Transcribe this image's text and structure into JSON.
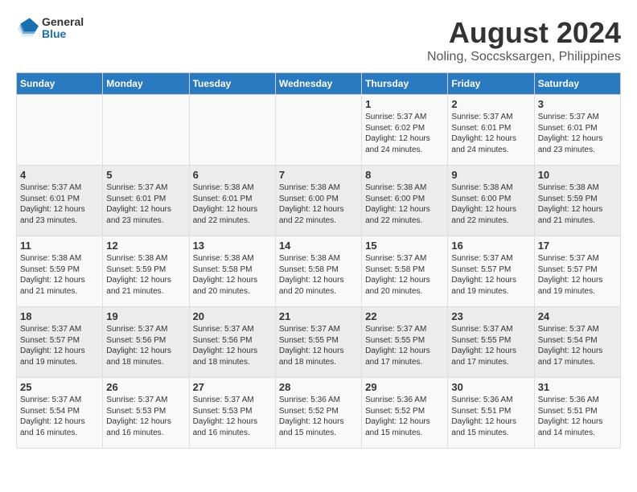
{
  "header": {
    "logo_general": "General",
    "logo_blue": "Blue",
    "main_title": "August 2024",
    "subtitle": "Noling, Soccsksargen, Philippines"
  },
  "calendar": {
    "days_of_week": [
      "Sunday",
      "Monday",
      "Tuesday",
      "Wednesday",
      "Thursday",
      "Friday",
      "Saturday"
    ],
    "weeks": [
      [
        {
          "day": "",
          "content": ""
        },
        {
          "day": "",
          "content": ""
        },
        {
          "day": "",
          "content": ""
        },
        {
          "day": "",
          "content": ""
        },
        {
          "day": "1",
          "content": "Sunrise: 5:37 AM\nSunset: 6:02 PM\nDaylight: 12 hours\nand 24 minutes."
        },
        {
          "day": "2",
          "content": "Sunrise: 5:37 AM\nSunset: 6:01 PM\nDaylight: 12 hours\nand 24 minutes."
        },
        {
          "day": "3",
          "content": "Sunrise: 5:37 AM\nSunset: 6:01 PM\nDaylight: 12 hours\nand 23 minutes."
        }
      ],
      [
        {
          "day": "4",
          "content": "Sunrise: 5:37 AM\nSunset: 6:01 PM\nDaylight: 12 hours\nand 23 minutes."
        },
        {
          "day": "5",
          "content": "Sunrise: 5:37 AM\nSunset: 6:01 PM\nDaylight: 12 hours\nand 23 minutes."
        },
        {
          "day": "6",
          "content": "Sunrise: 5:38 AM\nSunset: 6:01 PM\nDaylight: 12 hours\nand 22 minutes."
        },
        {
          "day": "7",
          "content": "Sunrise: 5:38 AM\nSunset: 6:00 PM\nDaylight: 12 hours\nand 22 minutes."
        },
        {
          "day": "8",
          "content": "Sunrise: 5:38 AM\nSunset: 6:00 PM\nDaylight: 12 hours\nand 22 minutes."
        },
        {
          "day": "9",
          "content": "Sunrise: 5:38 AM\nSunset: 6:00 PM\nDaylight: 12 hours\nand 22 minutes."
        },
        {
          "day": "10",
          "content": "Sunrise: 5:38 AM\nSunset: 5:59 PM\nDaylight: 12 hours\nand 21 minutes."
        }
      ],
      [
        {
          "day": "11",
          "content": "Sunrise: 5:38 AM\nSunset: 5:59 PM\nDaylight: 12 hours\nand 21 minutes."
        },
        {
          "day": "12",
          "content": "Sunrise: 5:38 AM\nSunset: 5:59 PM\nDaylight: 12 hours\nand 21 minutes."
        },
        {
          "day": "13",
          "content": "Sunrise: 5:38 AM\nSunset: 5:58 PM\nDaylight: 12 hours\nand 20 minutes."
        },
        {
          "day": "14",
          "content": "Sunrise: 5:38 AM\nSunset: 5:58 PM\nDaylight: 12 hours\nand 20 minutes."
        },
        {
          "day": "15",
          "content": "Sunrise: 5:37 AM\nSunset: 5:58 PM\nDaylight: 12 hours\nand 20 minutes."
        },
        {
          "day": "16",
          "content": "Sunrise: 5:37 AM\nSunset: 5:57 PM\nDaylight: 12 hours\nand 19 minutes."
        },
        {
          "day": "17",
          "content": "Sunrise: 5:37 AM\nSunset: 5:57 PM\nDaylight: 12 hours\nand 19 minutes."
        }
      ],
      [
        {
          "day": "18",
          "content": "Sunrise: 5:37 AM\nSunset: 5:57 PM\nDaylight: 12 hours\nand 19 minutes."
        },
        {
          "day": "19",
          "content": "Sunrise: 5:37 AM\nSunset: 5:56 PM\nDaylight: 12 hours\nand 18 minutes."
        },
        {
          "day": "20",
          "content": "Sunrise: 5:37 AM\nSunset: 5:56 PM\nDaylight: 12 hours\nand 18 minutes."
        },
        {
          "day": "21",
          "content": "Sunrise: 5:37 AM\nSunset: 5:55 PM\nDaylight: 12 hours\nand 18 minutes."
        },
        {
          "day": "22",
          "content": "Sunrise: 5:37 AM\nSunset: 5:55 PM\nDaylight: 12 hours\nand 17 minutes."
        },
        {
          "day": "23",
          "content": "Sunrise: 5:37 AM\nSunset: 5:55 PM\nDaylight: 12 hours\nand 17 minutes."
        },
        {
          "day": "24",
          "content": "Sunrise: 5:37 AM\nSunset: 5:54 PM\nDaylight: 12 hours\nand 17 minutes."
        }
      ],
      [
        {
          "day": "25",
          "content": "Sunrise: 5:37 AM\nSunset: 5:54 PM\nDaylight: 12 hours\nand 16 minutes."
        },
        {
          "day": "26",
          "content": "Sunrise: 5:37 AM\nSunset: 5:53 PM\nDaylight: 12 hours\nand 16 minutes."
        },
        {
          "day": "27",
          "content": "Sunrise: 5:37 AM\nSunset: 5:53 PM\nDaylight: 12 hours\nand 16 minutes."
        },
        {
          "day": "28",
          "content": "Sunrise: 5:36 AM\nSunset: 5:52 PM\nDaylight: 12 hours\nand 15 minutes."
        },
        {
          "day": "29",
          "content": "Sunrise: 5:36 AM\nSunset: 5:52 PM\nDaylight: 12 hours\nand 15 minutes."
        },
        {
          "day": "30",
          "content": "Sunrise: 5:36 AM\nSunset: 5:51 PM\nDaylight: 12 hours\nand 15 minutes."
        },
        {
          "day": "31",
          "content": "Sunrise: 5:36 AM\nSunset: 5:51 PM\nDaylight: 12 hours\nand 14 minutes."
        }
      ]
    ]
  }
}
